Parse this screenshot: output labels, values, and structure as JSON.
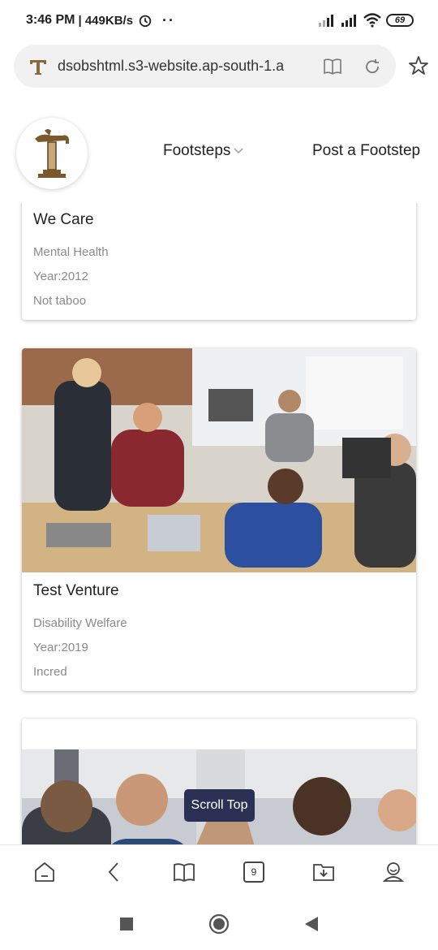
{
  "status_bar": {
    "time": "3:46 PM",
    "network_speed": "| 449KB/s",
    "overflow_dots": "··",
    "battery": "69"
  },
  "browser": {
    "url": "dsobshtml.s3-website.ap-south-1.a",
    "tabs_count": "9"
  },
  "nav": {
    "footsteps": "Footsteps",
    "post": "Post a Footstep"
  },
  "cards": [
    {
      "title": "We Care",
      "category": "Mental Health",
      "year": "Year:2012",
      "tagline": "Not taboo"
    },
    {
      "title": "Test Venture",
      "category": "Disability Welfare",
      "year": "Year:2019",
      "tagline": "Incred"
    }
  ],
  "scroll_top_label": "Scroll Top",
  "colors": {
    "scroll_top_bg": "#2b3054",
    "meta_text": "#8a8a8a"
  }
}
